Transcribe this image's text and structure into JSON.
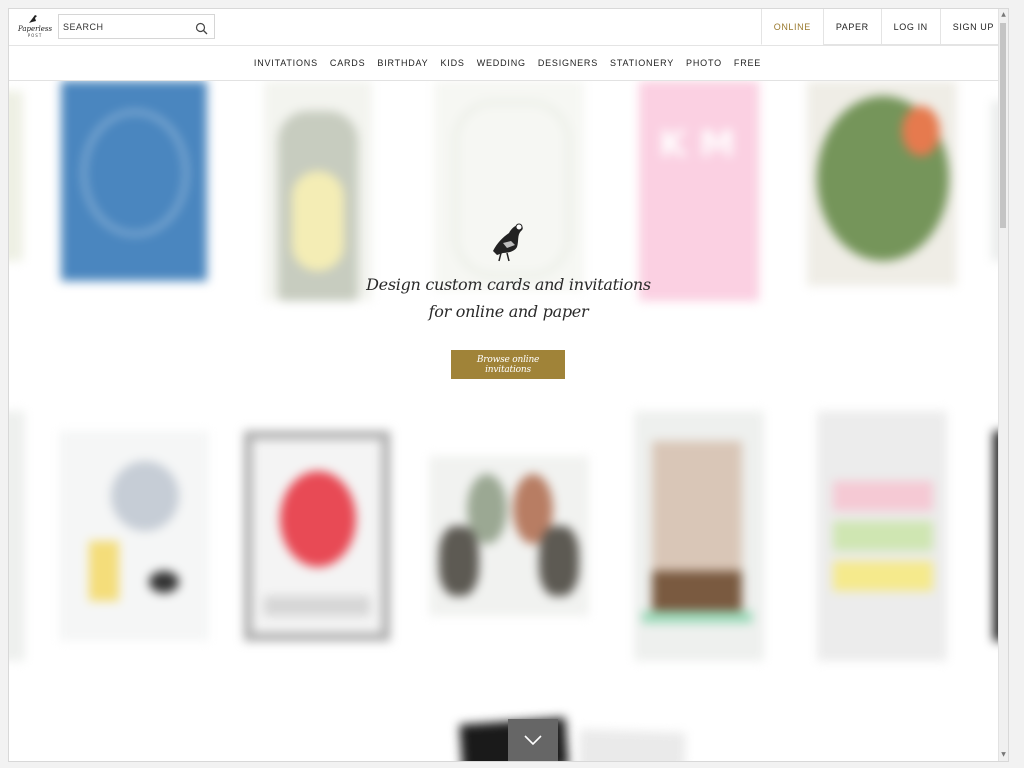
{
  "brand": {
    "name": "Paperless",
    "sub": "POST"
  },
  "search": {
    "placeholder": "SEARCH"
  },
  "tabs": [
    {
      "label": "ONLINE",
      "active": true
    },
    {
      "label": "PAPER",
      "active": false
    },
    {
      "label": "LOG IN",
      "active": false
    },
    {
      "label": "SIGN UP",
      "active": false
    }
  ],
  "nav": [
    "INVITATIONS",
    "CARDS",
    "BIRTHDAY",
    "KIDS",
    "WEDDING",
    "DESIGNERS",
    "STATIONERY",
    "PHOTO",
    "FREE"
  ],
  "hero": {
    "tagline_line1": "Design custom cards and invitations",
    "tagline_line2": "for online and paper",
    "cta": "Browse online invitations"
  },
  "colors": {
    "accent": "#a08338",
    "active_tab": "#9a7a2f"
  },
  "icons": {
    "search": "magnifier-icon",
    "logo": "pigeon-icon",
    "scroll": "chevron-down-icon"
  }
}
